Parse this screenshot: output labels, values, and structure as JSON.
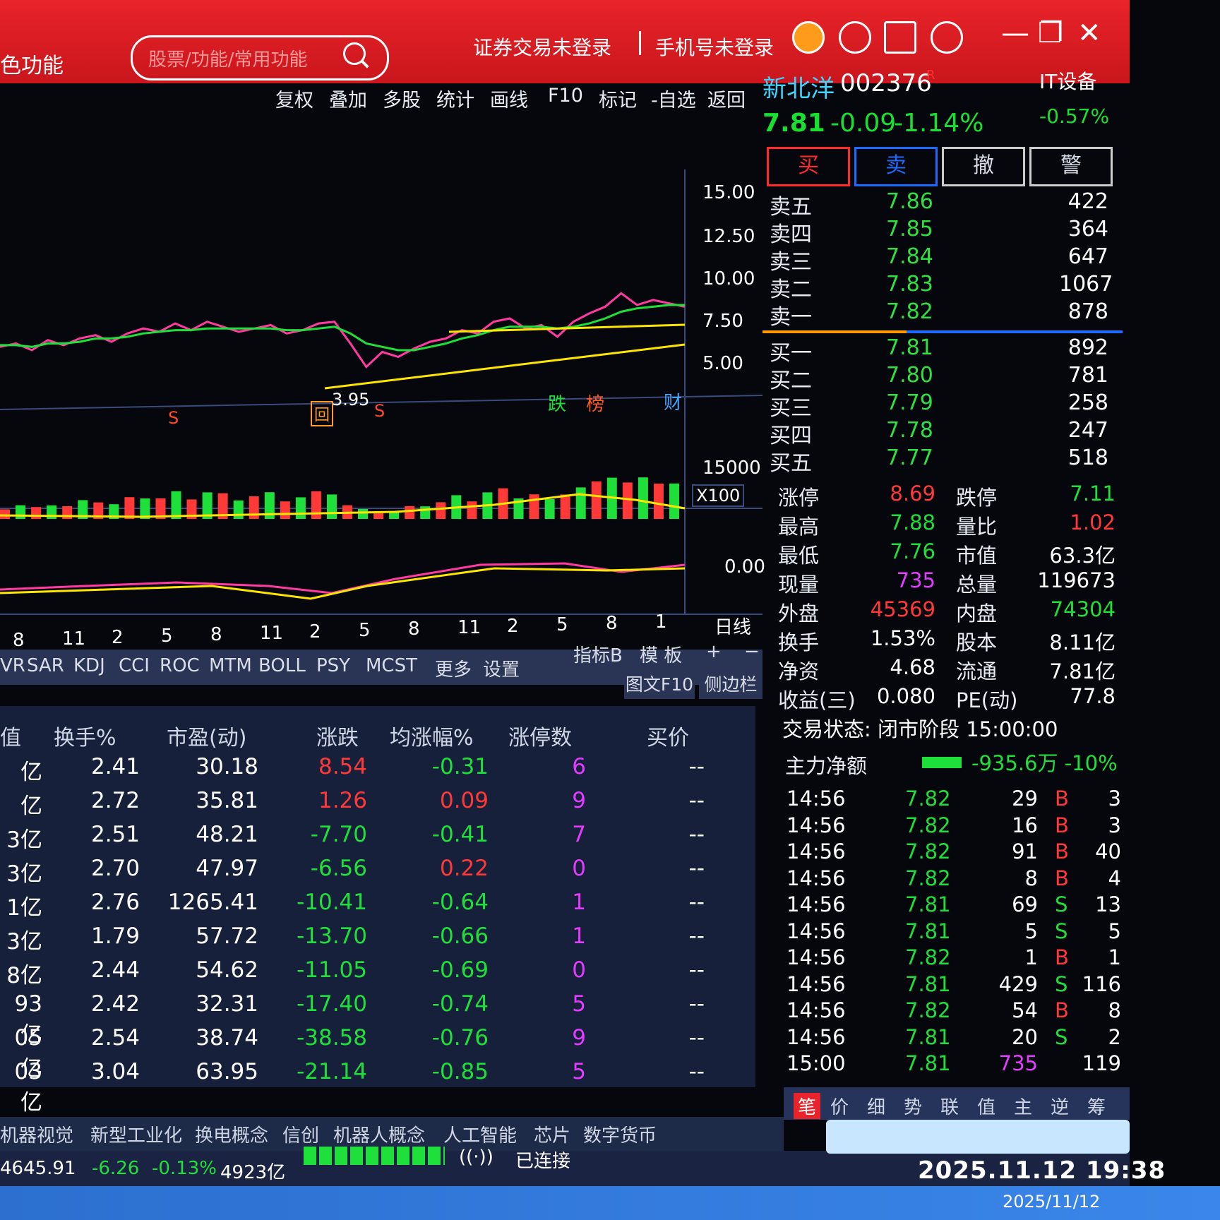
{
  "titlebar": {
    "app_title": "色功能",
    "search_placeholder": "股票/功能/常用功能",
    "trade_login": "证券交易未登录",
    "phone_login": "手机号未登录",
    "icons": [
      "alert-icon",
      "headset-icon",
      "document-icon",
      "gear-icon"
    ],
    "min": "—",
    "max": "❐",
    "close": "✕"
  },
  "menu": {
    "items": [
      "复权",
      "叠加",
      "多股",
      "统计",
      "画线",
      "F10",
      "标记",
      "-自选",
      "返回"
    ]
  },
  "stock": {
    "name": "新北洋",
    "code": "002376",
    "flag": "R",
    "industry": "IT设备",
    "price": "7.81",
    "change": "-0.09",
    "change_pct": "-1.14%",
    "industry_pct": "-0.57%"
  },
  "trade_buttons": {
    "buy": "买",
    "sell": "卖",
    "cancel": "撤",
    "alert": "警"
  },
  "colors": {
    "up": "#ff3838",
    "down": "#1fe03a",
    "accent": "#3fd5ff",
    "title_red": "#dd1d23"
  },
  "chart_data": {
    "type": "line",
    "title": "",
    "xlabel": "",
    "ylabel": "",
    "ylim": [
      2.5,
      16
    ],
    "y_ticks": [
      "15.00",
      "12.50",
      "10.00",
      "7.50",
      "5.00"
    ],
    "x_ticks": [
      "8",
      "11",
      "2",
      "5",
      "8",
      "11",
      "2",
      "5",
      "8",
      "11",
      "2",
      "5",
      "8",
      "1"
    ],
    "period": "日线",
    "annotation_low": "3.95",
    "markers": [
      "S",
      "回",
      "S",
      "跌",
      "榜",
      "财"
    ],
    "series": [
      {
        "values": [
          5.4,
          5.6,
          5.2,
          5.8,
          5.5,
          5.9,
          6.1,
          5.7,
          6.2,
          6.5,
          6.3,
          6.8,
          6.4,
          6.9,
          6.6,
          6.3,
          6.5,
          6.7,
          6.2,
          6.4,
          6.8,
          6.9,
          5.6,
          4.2,
          5.1,
          4.8,
          5.3,
          5.7,
          5.9,
          6.4,
          6.2,
          6.9,
          7.1,
          6.5,
          6.7,
          6.0,
          6.9,
          7.4,
          7.8,
          8.6,
          7.9,
          8.2,
          8.0,
          7.8
        ]
      },
      {
        "values": [
          5.5,
          5.5,
          5.4,
          5.6,
          5.6,
          5.7,
          5.9,
          5.9,
          6.0,
          6.2,
          6.3,
          6.4,
          6.4,
          6.5,
          6.5,
          6.5,
          6.5,
          6.5,
          6.4,
          6.4,
          6.5,
          6.6,
          6.2,
          5.6,
          5.4,
          5.2,
          5.2,
          5.4,
          5.6,
          5.9,
          6.1,
          6.4,
          6.6,
          6.6,
          6.6,
          6.5,
          6.6,
          6.8,
          7.1,
          7.5,
          7.7,
          7.8,
          7.9,
          7.9
        ]
      }
    ],
    "volume_axis": "15000",
    "volume_unit": "X100",
    "macd_axis": "0.00"
  },
  "orderbook": {
    "sell": [
      {
        "label": "卖五",
        "price": "7.86",
        "vol": "422"
      },
      {
        "label": "卖四",
        "price": "7.85",
        "vol": "364"
      },
      {
        "label": "卖三",
        "price": "7.84",
        "vol": "647"
      },
      {
        "label": "卖二",
        "price": "7.83",
        "vol": "1067"
      },
      {
        "label": "卖一",
        "price": "7.82",
        "vol": "878"
      }
    ],
    "buy": [
      {
        "label": "买一",
        "price": "7.81",
        "vol": "892"
      },
      {
        "label": "买二",
        "price": "7.80",
        "vol": "781"
      },
      {
        "label": "买三",
        "price": "7.79",
        "vol": "258"
      },
      {
        "label": "买四",
        "price": "7.78",
        "vol": "247"
      },
      {
        "label": "买五",
        "price": "7.77",
        "vol": "518"
      }
    ]
  },
  "stats": [
    {
      "l": "涨停",
      "v": "8.69",
      "c": "#ff3838",
      "l2": "跌停",
      "v2": "7.11",
      "c2": "#1fe03a"
    },
    {
      "l": "最高",
      "v": "7.88",
      "c": "#1fe03a",
      "l2": "量比",
      "v2": "1.02",
      "c2": "#ff3838"
    },
    {
      "l": "最低",
      "v": "7.76",
      "c": "#1fe03a",
      "l2": "市值",
      "v2": "63.3亿",
      "c2": "#ffffff"
    },
    {
      "l": "现量",
      "v": "735",
      "c": "#e23cff",
      "l2": "总量",
      "v2": "119673",
      "c2": "#ffffff"
    },
    {
      "l": "外盘",
      "v": "45369",
      "c": "#ff3838",
      "l2": "内盘",
      "v2": "74304",
      "c2": "#1fe03a"
    },
    {
      "l": "换手",
      "v": "1.53%",
      "c": "#ffffff",
      "l2": "股本",
      "v2": "8.11亿",
      "c2": "#ffffff"
    },
    {
      "l": "净资",
      "v": "4.68",
      "c": "#ffffff",
      "l2": "流通",
      "v2": "7.81亿",
      "c2": "#ffffff"
    },
    {
      "l": "收益(三)",
      "v": "0.080",
      "c": "#ffffff",
      "l2": "PE(动)",
      "v2": "77.8",
      "c2": "#ffffff"
    }
  ],
  "trade_status": "交易状态: 闭市阶段 15:00:00",
  "main_flow": {
    "label": "主力净额",
    "value": "-935.6万 -10%"
  },
  "ticks": [
    {
      "t": "14:56",
      "p": "7.82",
      "v": "29",
      "d": "B",
      "n": "3"
    },
    {
      "t": "14:56",
      "p": "7.82",
      "v": "16",
      "d": "B",
      "n": "3"
    },
    {
      "t": "14:56",
      "p": "7.82",
      "v": "91",
      "d": "B",
      "n": "40"
    },
    {
      "t": "14:56",
      "p": "7.82",
      "v": "8",
      "d": "B",
      "n": "4"
    },
    {
      "t": "14:56",
      "p": "7.81",
      "v": "69",
      "d": "S",
      "n": "13"
    },
    {
      "t": "14:56",
      "p": "7.81",
      "v": "5",
      "d": "S",
      "n": "5"
    },
    {
      "t": "14:56",
      "p": "7.82",
      "v": "1",
      "d": "B",
      "n": "1"
    },
    {
      "t": "14:56",
      "p": "7.81",
      "v": "429",
      "d": "S",
      "n": "116"
    },
    {
      "t": "14:56",
      "p": "7.82",
      "v": "54",
      "d": "B",
      "n": "8"
    },
    {
      "t": "14:56",
      "p": "7.81",
      "v": "20",
      "d": "S",
      "n": "2"
    },
    {
      "t": "15:00",
      "p": "7.81",
      "v": "735",
      "d": "",
      "n": "119"
    }
  ],
  "indicator_tabs": [
    "VR",
    "SAR",
    "KDJ",
    "CCI",
    "ROC",
    "MTM",
    "BOLL",
    "PSY",
    "MCST",
    "更多",
    "设置"
  ],
  "indicator_right": [
    "指标B",
    "模 板",
    "+",
    "−"
  ],
  "chart_buttons": [
    "图文F10",
    "侧边栏"
  ],
  "table": {
    "headers": [
      "值",
      "换手%",
      "市盈(动)",
      "涨跌",
      "均涨幅%",
      "涨停数",
      "买价"
    ],
    "rows": [
      {
        "a": "亿",
        "b": "2.41",
        "c": "30.18",
        "d": "8.54",
        "e": "-0.31",
        "f": "6",
        "g": "--"
      },
      {
        "a": "亿",
        "b": "2.72",
        "c": "35.81",
        "d": "1.26",
        "e": "0.09",
        "f": "9",
        "g": "--"
      },
      {
        "a": "3亿",
        "b": "2.51",
        "c": "48.21",
        "d": "-7.70",
        "e": "-0.41",
        "f": "7",
        "g": "--"
      },
      {
        "a": "3亿",
        "b": "2.70",
        "c": "47.97",
        "d": "-6.56",
        "e": "0.22",
        "f": "0",
        "g": "--"
      },
      {
        "a": "1亿",
        "b": "2.76",
        "c": "1265.41",
        "d": "-10.41",
        "e": "-0.64",
        "f": "1",
        "g": "--"
      },
      {
        "a": "3亿",
        "b": "1.79",
        "c": "57.72",
        "d": "-13.70",
        "e": "-0.66",
        "f": "1",
        "g": "--"
      },
      {
        "a": "8亿",
        "b": "2.44",
        "c": "54.62",
        "d": "-11.05",
        "e": "-0.69",
        "f": "0",
        "g": "--"
      },
      {
        "a": "93亿",
        "b": "2.42",
        "c": "32.31",
        "d": "-17.40",
        "e": "-0.74",
        "f": "5",
        "g": "--"
      },
      {
        "a": "05亿",
        "b": "2.54",
        "c": "38.74",
        "d": "-38.58",
        "e": "-0.76",
        "f": "9",
        "g": "--"
      },
      {
        "a": "03亿",
        "b": "3.04",
        "c": "63.95",
        "d": "-21.14",
        "e": "-0.85",
        "f": "5",
        "g": "--"
      }
    ]
  },
  "bottom_tabs": [
    "机器视觉",
    "新型工业化",
    "换电概念",
    "信创",
    "机器人概念",
    "人工智能",
    "芯片",
    "数字货币"
  ],
  "right_tabs": [
    "笔",
    "价",
    "细",
    "势",
    "联",
    "值",
    "主",
    "逆",
    "筹"
  ],
  "status": {
    "index": "4645.91",
    "chg": "-6.26",
    "pct": "-0.13%",
    "amount": "4923亿",
    "conn": "已连接"
  },
  "clock": "2025.11.12 19:38",
  "date_small": "2025/11/12"
}
